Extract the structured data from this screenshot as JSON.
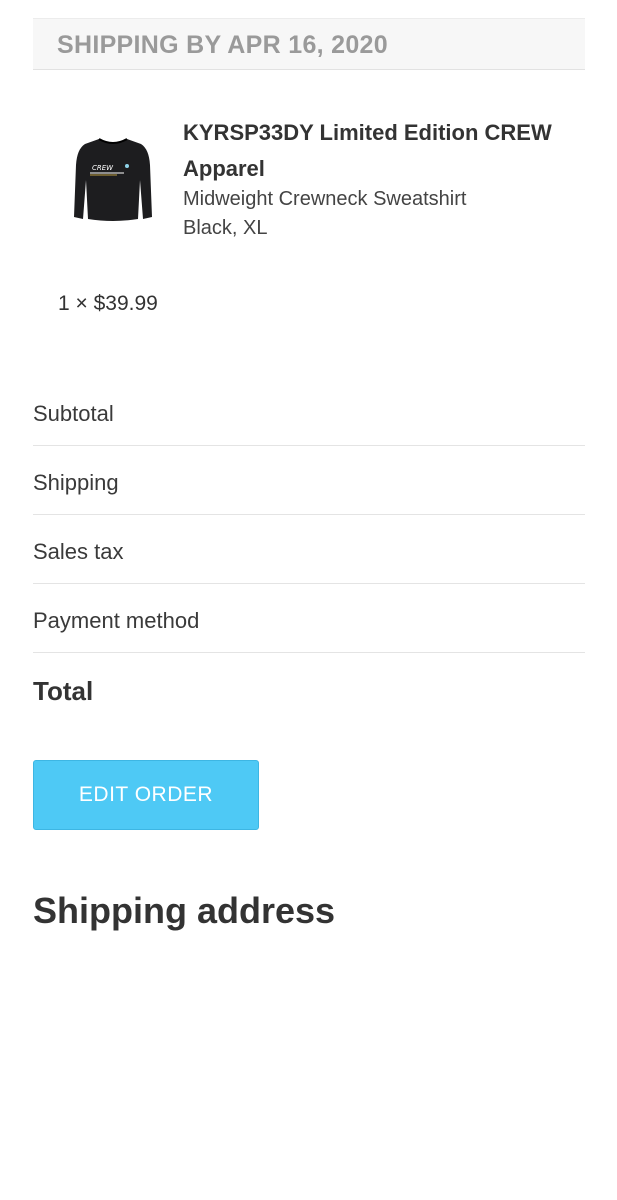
{
  "shipping_banner": {
    "text": "SHIPPING BY APR 16, 2020"
  },
  "product": {
    "name": "KYRSP33DY Limited Edition CREW Apparel",
    "description_line1": "Midweight Crewneck Sweatshirt",
    "description_line2": "Black, XL",
    "image_icon": "sweatshirt-image",
    "image_text": "CREW",
    "quantity_price": "1 × $39.99"
  },
  "summary": {
    "rows": [
      {
        "label": "Subtotal",
        "value": ""
      },
      {
        "label": "Shipping",
        "value": ""
      },
      {
        "label": "Sales tax",
        "value": ""
      },
      {
        "label": "Payment method",
        "value": ""
      }
    ],
    "total_label": "Total",
    "total_value": ""
  },
  "actions": {
    "edit_order_label": "EDIT ORDER"
  },
  "shipping_address": {
    "heading": "Shipping address"
  },
  "colors": {
    "accent": "#4ec9f5",
    "banner_bg": "#f7f7f7",
    "banner_text": "#9a9a9a"
  }
}
